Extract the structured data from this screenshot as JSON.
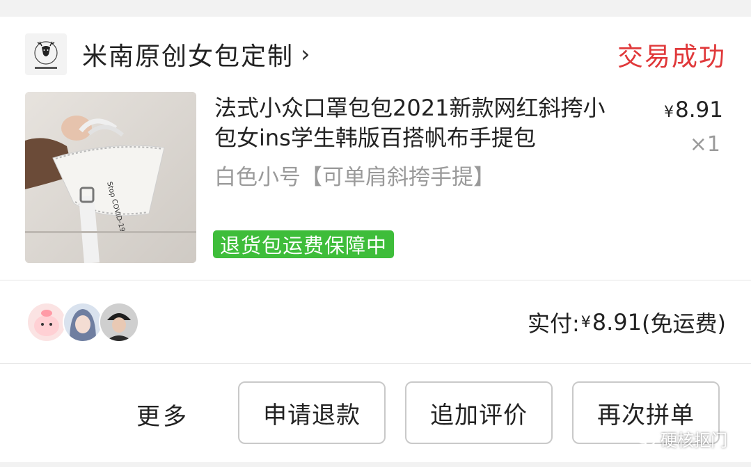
{
  "shop": {
    "name": "米南原创女包定制",
    "logo_text": "米南原创女包定制",
    "status": "交易成功"
  },
  "product": {
    "title": "法式小众口罩包包2021新款网红斜挎小包女ins学生韩版百搭帆布手提包",
    "variant": "白色小号【可单肩斜挎手提】",
    "currency": "¥",
    "price": "8.91",
    "quantity": "×1",
    "badge": "退货包运费保障中",
    "image_print": "Stop COVID-19"
  },
  "summary": {
    "paid_label": "实付:",
    "currency": "¥",
    "paid_amount": "8.91",
    "shipping_note": "(免运费)"
  },
  "actions": {
    "more": "更多",
    "refund": "申请退款",
    "review": "追加评价",
    "reorder": "再次拼单"
  },
  "watermark": {
    "text": "硬核抠门"
  },
  "colors": {
    "status_red": "#e0383a",
    "badge_green": "#3ebd3a",
    "muted_gray": "#9a9a9a"
  }
}
